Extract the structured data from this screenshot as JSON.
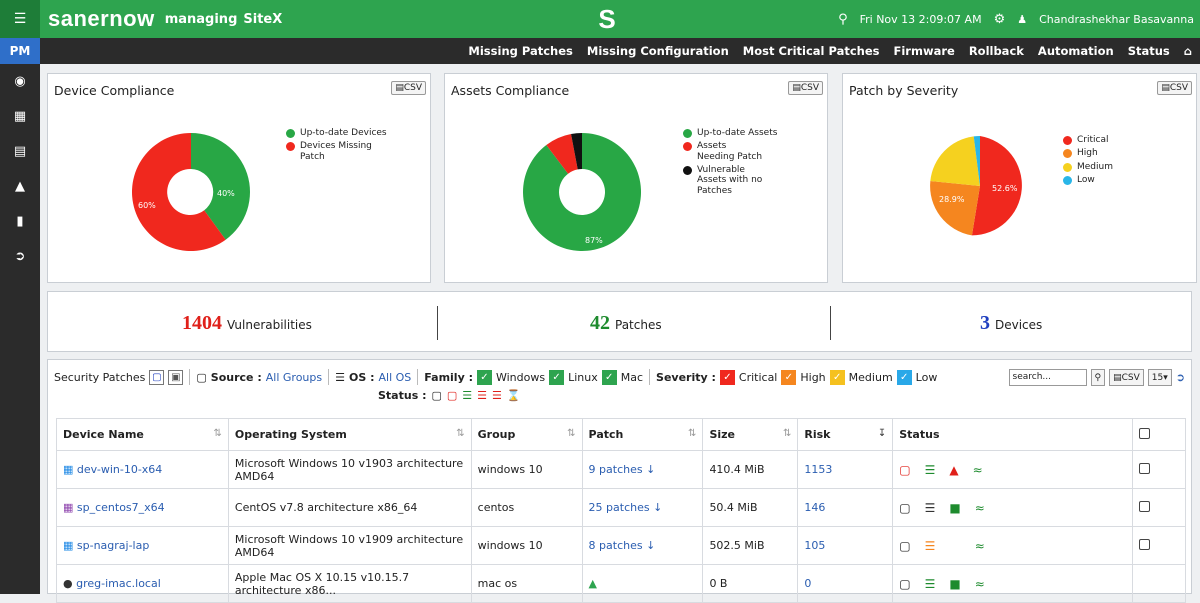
{
  "header": {
    "brand": "sanernow",
    "managing_label": "managing",
    "site": "SiteX",
    "logo_letter": "S",
    "datetime": "Fri Nov 13  2:09:07 AM",
    "user": "Chandrashekhar Basavanna"
  },
  "nav": {
    "items": [
      "Missing Patches",
      "Missing Configuration",
      "Most Critical Patches",
      "Firmware",
      "Rollback",
      "Automation",
      "Status"
    ]
  },
  "sidebar": {
    "active": "PM",
    "icons": [
      "eye-icon",
      "dashboard-icon",
      "list-icon",
      "alert-icon",
      "book-icon",
      "logout-icon"
    ]
  },
  "cards": [
    {
      "title": "Device Compliance",
      "csv": "CSV",
      "legend": [
        {
          "label": "Up-to-date Devices",
          "color": "#28a745"
        },
        {
          "label": "Devices Missing Patch",
          "color": "#f0281e"
        }
      ],
      "labels": [
        "40%",
        "60%"
      ]
    },
    {
      "title": "Assets Compliance",
      "csv": "CSV",
      "legend": [
        {
          "label": "Up-to-date Assets",
          "color": "#28a745"
        },
        {
          "label": "Assets Needing Patch",
          "color": "#f0281e"
        },
        {
          "label": "Vulnerable Assets with no Patches",
          "color": "#111111"
        }
      ],
      "labels": [
        "87%"
      ]
    },
    {
      "title": "Patch by Severity",
      "csv": "CSV",
      "legend": [
        {
          "label": "Critical",
          "color": "#f0281e"
        },
        {
          "label": "High",
          "color": "#f5861f"
        },
        {
          "label": "Medium",
          "color": "#f5d11f"
        },
        {
          "label": "Low",
          "color": "#29b6e8"
        }
      ],
      "labels": [
        "52.6%",
        "28.9%"
      ]
    }
  ],
  "chart_data": [
    {
      "type": "pie",
      "title": "Device Compliance",
      "categories": [
        "Up-to-date Devices",
        "Devices Missing Patch"
      ],
      "values": [
        40,
        60
      ]
    },
    {
      "type": "pie",
      "title": "Assets Compliance",
      "categories": [
        "Up-to-date Assets",
        "Assets Needing Patch",
        "Vulnerable Assets with no Patches"
      ],
      "values": [
        87,
        10,
        3
      ]
    },
    {
      "type": "pie",
      "title": "Patch by Severity",
      "categories": [
        "Critical",
        "High",
        "Medium",
        "Low"
      ],
      "values": [
        52.6,
        28.9,
        16.5,
        2
      ]
    }
  ],
  "stats": {
    "vulnerabilities": {
      "value": "1404",
      "label": "Vulnerabilities",
      "color": "#e0201a"
    },
    "patches": {
      "value": "42",
      "label": "Patches",
      "color": "#1e8b2e"
    },
    "devices": {
      "value": "3",
      "label": "Devices",
      "color": "#1f3fbf"
    }
  },
  "security": {
    "label": "Security Patches",
    "source_label": "Source :",
    "source_value": "All Groups",
    "os_label": "OS :",
    "os_value": "All OS",
    "family_label": "Family :",
    "families": [
      "Windows",
      "Linux",
      "Mac"
    ],
    "severity_label": "Severity :",
    "severities": [
      "Critical",
      "High",
      "Medium",
      "Low"
    ],
    "status_label": "Status :",
    "search_placeholder": "search...",
    "csv": "CSV",
    "page_size": "15"
  },
  "table": {
    "headers": [
      "Device Name",
      "Operating System",
      "Group",
      "Patch",
      "Size",
      "Risk",
      "Status"
    ],
    "rows": [
      {
        "device": "dev-win-10-x64",
        "os": "Microsoft Windows 10 v1903 architecture AMD64",
        "group": "windows 10",
        "patch": "9 patches",
        "size": "410.4 MiB",
        "risk": "1153"
      },
      {
        "device": "sp_centos7_x64",
        "os": "CentOS v7.8 architecture x86_64",
        "group": "centos",
        "patch": "25 patches",
        "size": "50.4 MiB",
        "risk": "146"
      },
      {
        "device": "sp-nagraj-lap",
        "os": "Microsoft Windows 10 v1909 architecture AMD64",
        "group": "windows 10",
        "patch": "8 patches",
        "size": "502.5 MiB",
        "risk": "105"
      },
      {
        "device": "greg-imac.local",
        "os": "Apple Mac OS X 10.15 v10.15.7 architecture x86...",
        "group": "mac os",
        "patch": "",
        "size": "0 B",
        "risk": "0"
      }
    ]
  }
}
